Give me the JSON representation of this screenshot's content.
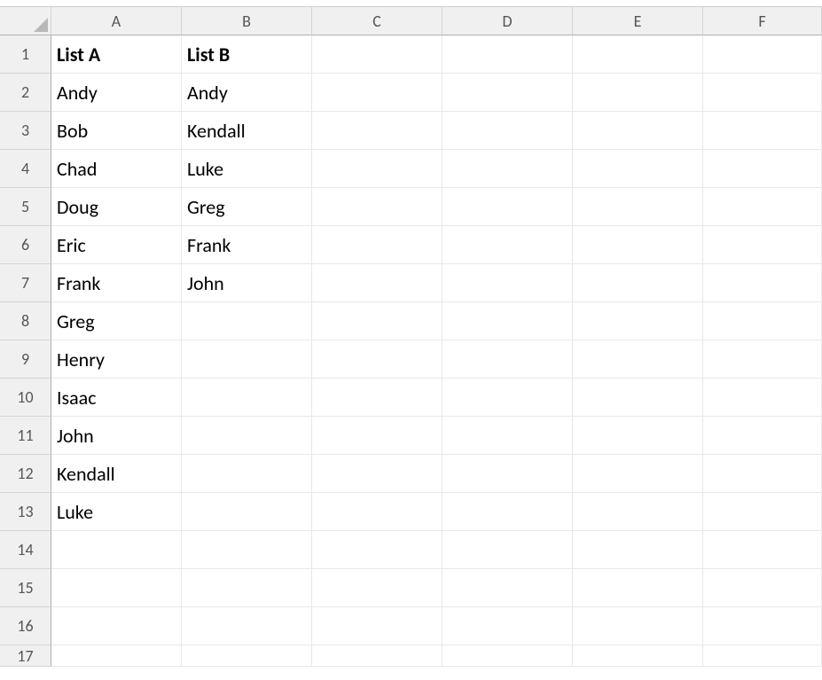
{
  "columns": [
    "A",
    "B",
    "C",
    "D",
    "E",
    "F"
  ],
  "rowNumbers": [
    "1",
    "2",
    "3",
    "4",
    "5",
    "6",
    "7",
    "8",
    "9",
    "10",
    "11",
    "12",
    "13",
    "14",
    "15",
    "16",
    "17"
  ],
  "cells": {
    "r1": {
      "A": "List A",
      "B": "List B",
      "C": "",
      "D": "",
      "E": "",
      "F": ""
    },
    "r2": {
      "A": "Andy",
      "B": "Andy",
      "C": "",
      "D": "",
      "E": "",
      "F": ""
    },
    "r3": {
      "A": "Bob",
      "B": "Kendall",
      "C": "",
      "D": "",
      "E": "",
      "F": ""
    },
    "r4": {
      "A": "Chad",
      "B": "Luke",
      "C": "",
      "D": "",
      "E": "",
      "F": ""
    },
    "r5": {
      "A": "Doug",
      "B": "Greg",
      "C": "",
      "D": "",
      "E": "",
      "F": ""
    },
    "r6": {
      "A": "Eric",
      "B": "Frank",
      "C": "",
      "D": "",
      "E": "",
      "F": ""
    },
    "r7": {
      "A": "Frank",
      "B": "John",
      "C": "",
      "D": "",
      "E": "",
      "F": ""
    },
    "r8": {
      "A": "Greg",
      "B": "",
      "C": "",
      "D": "",
      "E": "",
      "F": ""
    },
    "r9": {
      "A": "Henry",
      "B": "",
      "C": "",
      "D": "",
      "E": "",
      "F": ""
    },
    "r10": {
      "A": "Isaac",
      "B": "",
      "C": "",
      "D": "",
      "E": "",
      "F": ""
    },
    "r11": {
      "A": "John",
      "B": "",
      "C": "",
      "D": "",
      "E": "",
      "F": ""
    },
    "r12": {
      "A": "Kendall",
      "B": "",
      "C": "",
      "D": "",
      "E": "",
      "F": ""
    },
    "r13": {
      "A": "Luke",
      "B": "",
      "C": "",
      "D": "",
      "E": "",
      "F": ""
    },
    "r14": {
      "A": "",
      "B": "",
      "C": "",
      "D": "",
      "E": "",
      "F": ""
    },
    "r15": {
      "A": "",
      "B": "",
      "C": "",
      "D": "",
      "E": "",
      "F": ""
    },
    "r16": {
      "A": "",
      "B": "",
      "C": "",
      "D": "",
      "E": "",
      "F": ""
    },
    "r17": {
      "A": "",
      "B": "",
      "C": "",
      "D": "",
      "E": "",
      "F": ""
    }
  }
}
